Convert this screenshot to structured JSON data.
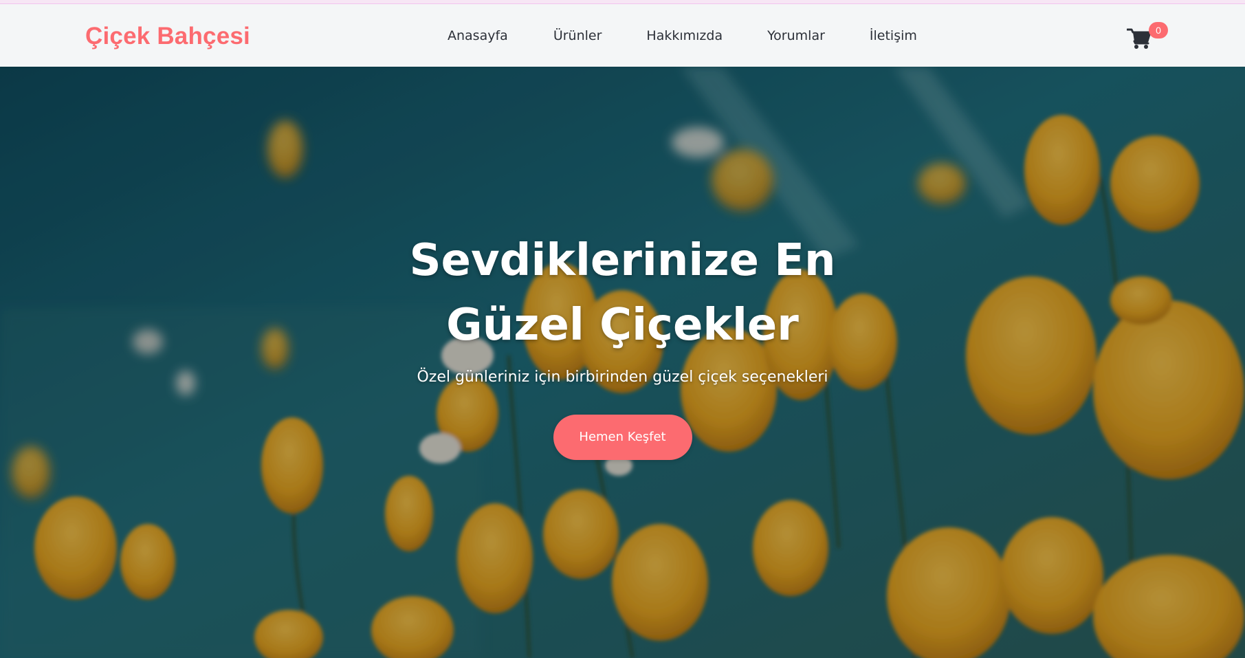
{
  "brand": {
    "name": "Çiçek Bahçesi",
    "color": "#fc6b70"
  },
  "nav": {
    "items": [
      {
        "label": "Anasayfa"
      },
      {
        "label": "Ürünler"
      },
      {
        "label": "Hakkımızda"
      },
      {
        "label": "Yorumlar"
      },
      {
        "label": "İletişim"
      }
    ]
  },
  "cart": {
    "icon": "shopping-cart-icon",
    "count": "0"
  },
  "hero": {
    "title": "Sevdiklerinize En Güzel Çiçekler",
    "subtitle": "Özel günleriniz için birbirinden güzel çiçek seçenekleri",
    "cta_label": "Hemen Keşfet"
  },
  "colors": {
    "accent": "#fc6b70",
    "nav_bg": "#f4f6f7",
    "text": "#2c3038"
  }
}
